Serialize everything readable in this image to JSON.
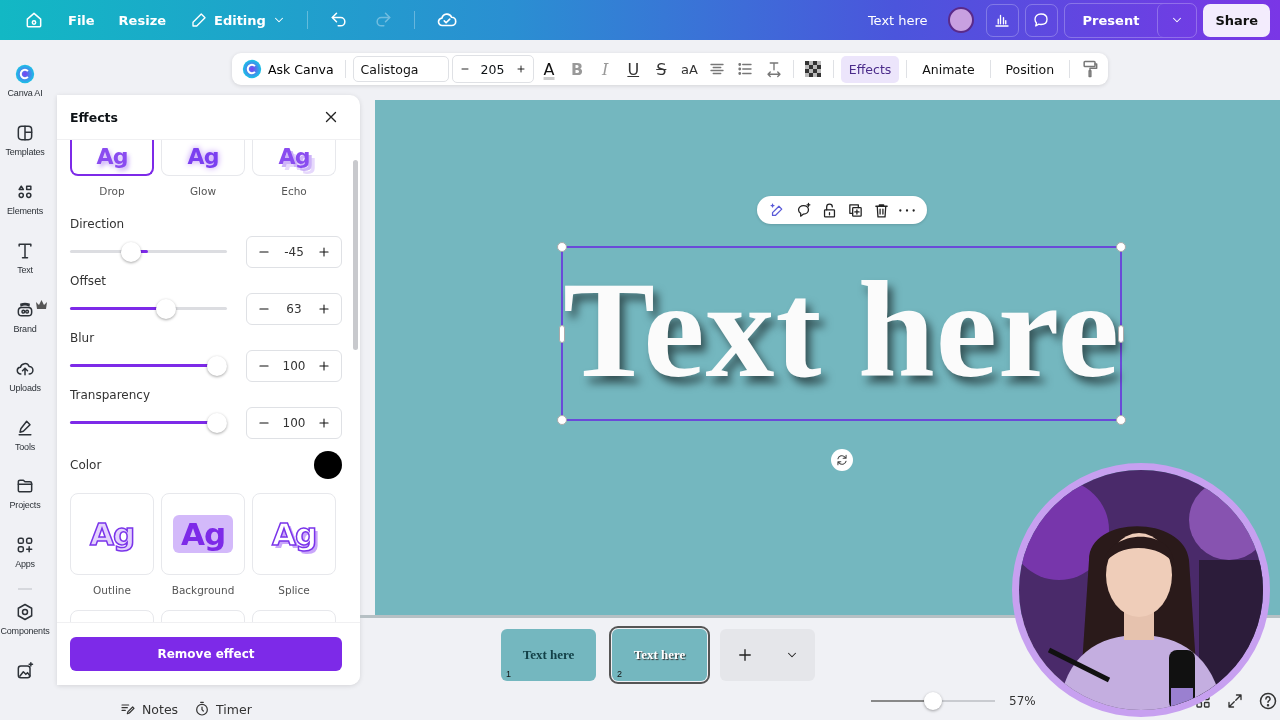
{
  "topbar": {
    "menu": [
      "File",
      "Resize"
    ],
    "mode": "Editing",
    "undo": {
      "disabled": false
    },
    "redo": {
      "disabled": true
    },
    "title": "Text here",
    "present": "Present",
    "share": "Share"
  },
  "toolbar": {
    "ask": "Ask Canva",
    "font": "Calistoga",
    "size": "205",
    "format_buttons": [
      {
        "glyph": "A",
        "kind": "color"
      },
      {
        "glyph": "B",
        "kind": "bold"
      },
      {
        "glyph": "I",
        "kind": "italic"
      },
      {
        "glyph": "U",
        "kind": "underline"
      },
      {
        "glyph": "S",
        "kind": "strike"
      },
      {
        "glyph": "aA",
        "kind": "case"
      }
    ],
    "tabs": [
      {
        "label": "Effects",
        "selected": true
      },
      {
        "label": "Animate",
        "selected": false
      },
      {
        "label": "Position",
        "selected": false
      }
    ]
  },
  "sidebar": {
    "items": [
      {
        "kind": "ai",
        "label": "Canva AI"
      },
      {
        "kind": "templates",
        "label": "Templates"
      },
      {
        "kind": "elements",
        "label": "Elements"
      },
      {
        "kind": "text",
        "label": "Text"
      },
      {
        "kind": "brand",
        "label": "Brand"
      },
      {
        "kind": "uploads",
        "label": "Uploads"
      },
      {
        "kind": "tools",
        "label": "Tools"
      },
      {
        "kind": "projects",
        "label": "Projects"
      },
      {
        "kind": "apps",
        "label": "Apps"
      },
      {
        "kind": "components",
        "label": "Components"
      },
      {
        "kind": "media"
      }
    ]
  },
  "effects_panel": {
    "title": "Effects",
    "styles_top": [
      {
        "kind": "drop",
        "sample": "Ag",
        "label": "Drop",
        "selected": true
      },
      {
        "kind": "glow",
        "sample": "Ag",
        "label": "Glow",
        "selected": false
      },
      {
        "kind": "echo",
        "sample": "Ag",
        "label": "Echo",
        "selected": false
      }
    ],
    "controls": [
      {
        "kind": "bipolar",
        "label": "Direction",
        "value": "-45",
        "level": 0.37
      },
      {
        "kind": "fill",
        "label": "Offset",
        "value": "63",
        "level": 0.63
      },
      {
        "kind": "fill",
        "label": "Blur",
        "value": "100",
        "level": 1
      },
      {
        "kind": "fill",
        "label": "Transparency",
        "value": "100",
        "level": 1
      }
    ],
    "color_label": "Color",
    "color": "#000000",
    "styles_bottom": [
      {
        "kind": "outline",
        "sample": "Ag",
        "label": "Outline",
        "selected": false
      },
      {
        "kind": "background",
        "sample": "Ag",
        "label": "Background",
        "selected": false
      },
      {
        "kind": "splice",
        "sample": "Ag",
        "label": "Splice",
        "selected": false
      }
    ],
    "remove_button": "Remove effect"
  },
  "canvas": {
    "text": "Text here"
  },
  "pages": [
    {
      "thumb_text": "Text here",
      "number": "1",
      "selected": false
    },
    {
      "thumb_text": "Text here",
      "number": "2",
      "selected": true
    }
  ],
  "footer": {
    "notes": "Notes",
    "timer": "Timer",
    "zoom": {
      "level": 0.5,
      "reading": "57%"
    }
  }
}
